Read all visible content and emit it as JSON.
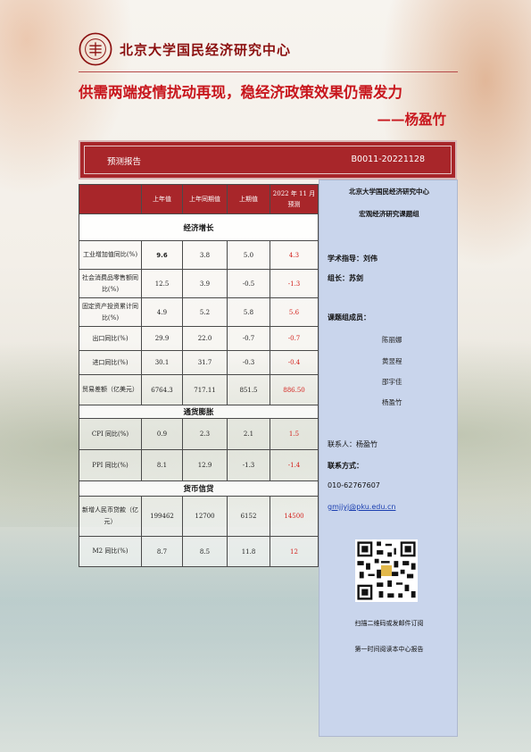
{
  "header": {
    "seal_text": "PEKING UNIVERSITY 1898",
    "org_title": "北京大学国民经济研究中心",
    "headline": "供需两端疫情扰动再现，稳经济政策效果仍需发力",
    "author": "——杨盈竹"
  },
  "report_bar": {
    "type": "预测报告",
    "code": "B0011-20221128"
  },
  "table": {
    "headers": [
      "",
      "上年值",
      "上年同期值",
      "上期值",
      "2022 年 11 月预测"
    ],
    "sections": [
      {
        "title": "经济增长",
        "rows": [
          {
            "label": "工业增加值同比(%)",
            "values": [
              "9.6",
              "3.8",
              "5.0",
              "4.3"
            ]
          },
          {
            "label": "社会消费品零售额同比(%)",
            "values": [
              "12.5",
              "3.9",
              "-0.5",
              "-1.3"
            ]
          },
          {
            "label": "固定资产投资累计同比(%)",
            "values": [
              "4.9",
              "5.2",
              "5.8",
              "5.6"
            ]
          },
          {
            "label": "出口同比(%)",
            "values": [
              "29.9",
              "22.0",
              "-0.7",
              "-0.7"
            ]
          },
          {
            "label": "进口同比(%)",
            "values": [
              "30.1",
              "31.7",
              "-0.3",
              "-0.4"
            ]
          },
          {
            "label": "贸易差额（亿美元）",
            "values": [
              "6764.3",
              "717.11",
              "851.5",
              "886.50"
            ]
          }
        ]
      },
      {
        "title": "通货膨胀",
        "rows": [
          {
            "label": "CPI 同比(%)",
            "values": [
              "0.9",
              "2.3",
              "2.1",
              "1.5"
            ]
          },
          {
            "label": "PPI 同比(%)",
            "values": [
              "8.1",
              "12.9",
              "-1.3",
              "-1.4"
            ]
          }
        ]
      },
      {
        "title": "货币信贷",
        "rows": [
          {
            "label": "新增人民币贷款（亿元）",
            "values": [
              "199462",
              "12700",
              "6152",
              "14500"
            ]
          },
          {
            "label": "M2 同比(%)",
            "values": [
              "8.7",
              "8.5",
              "11.8",
              "12"
            ]
          }
        ]
      }
    ]
  },
  "panel": {
    "org": "北京大学国民经济研究中心",
    "group": "宏观经济研究课题组",
    "advisor": "学术指导：刘伟",
    "leader": "组长：苏剑",
    "members_label": "课题组成员：",
    "members": [
      "陈丽娜",
      "黄昱程",
      "邵宇佳",
      "杨盈竹"
    ],
    "contact_person": "联系人：杨盈竹",
    "contact_label": "联系方式：",
    "phone": "010-62767607",
    "email": "gmjjyj@pku.edu.cn",
    "qr_label": "qr-code",
    "cta_line1": "扫描二维码或发邮件订阅",
    "cta_line2": "第一时间阅读本中心报告"
  },
  "colors": {
    "brand_red": "#a8262a",
    "headline_red": "#c8161d",
    "forecast_red": "#d3201b",
    "panel_blue": "#c9d5ec"
  }
}
